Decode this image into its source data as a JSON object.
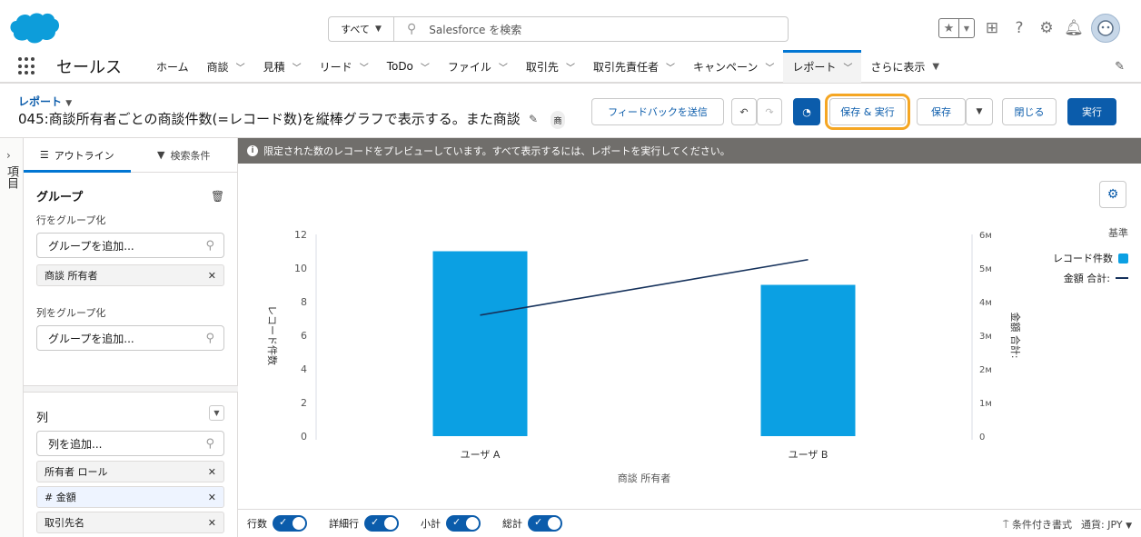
{
  "header": {
    "search_scope": "すべて",
    "search_placeholder": "Salesforce を検索"
  },
  "nav": {
    "app_name": "セールス",
    "items": [
      {
        "label": "ホーム"
      },
      {
        "label": "商談"
      },
      {
        "label": "見積"
      },
      {
        "label": "リード"
      },
      {
        "label": "ToDo"
      },
      {
        "label": "ファイル"
      },
      {
        "label": "取引先"
      },
      {
        "label": "取引先責任者"
      },
      {
        "label": "キャンペーン"
      },
      {
        "label": "レポート"
      },
      {
        "label": "さらに表示"
      }
    ]
  },
  "report": {
    "type_label": "レポート",
    "title": "045:商談所有者ごとの商談件数(=レコード数)を縦棒グラフで表示する。また商談",
    "more_label": "商",
    "buttons": {
      "feedback": "フィードバックを送信",
      "save_run": "保存 & 実行",
      "save": "保存",
      "close": "閉じる",
      "run": "実行"
    }
  },
  "rail": {
    "label": "項目"
  },
  "outline": {
    "tab_outline": "アウトライン",
    "tab_filters": "検索条件",
    "groups_title": "グループ",
    "group_rows_label": "行をグループ化",
    "group_placeholder": "グループを追加...",
    "row_group_pill": "商談 所有者",
    "group_cols_label": "列をグループ化",
    "col_group_placeholder": "グループを追加...",
    "columns_title": "列",
    "column_placeholder": "列を追加...",
    "columns": [
      {
        "label": "所有者 ロール"
      },
      {
        "label": "# 金額"
      },
      {
        "label": "取引先名"
      }
    ]
  },
  "preview": {
    "notice": "限定された数のレコードをプレビューしています。すべて表示するには、レポートを実行してください。"
  },
  "chart_data": {
    "type": "bar",
    "categories": [
      "ユーザ A",
      "ユーザ B"
    ],
    "series": [
      {
        "name": "レコード件数",
        "type": "bar",
        "axis": "left",
        "values": [
          11,
          9
        ],
        "color": "#0ba0e3"
      },
      {
        "name": "金額 合計:",
        "type": "line",
        "axis": "right",
        "values": [
          3600000,
          5250000
        ],
        "color": "#16325c"
      }
    ],
    "xlabel": "商談 所有者",
    "ylabel": "レコード件数",
    "y2label": "金額 合計:",
    "ylim": [
      0,
      12
    ],
    "y2lim": [
      0,
      6000000
    ],
    "yticks": [
      "0",
      "2",
      "4",
      "6",
      "8",
      "10",
      "12"
    ],
    "y2ticks": [
      "0",
      "1м",
      "2м",
      "3м",
      "4м",
      "5м",
      "6м"
    ],
    "legend_title": "基準",
    "legend_position": "top-right"
  },
  "footer": {
    "toggles": [
      {
        "label": "行数"
      },
      {
        "label": "詳細行"
      },
      {
        "label": "小計"
      },
      {
        "label": "総計"
      }
    ],
    "conditional_format": "条件付き書式",
    "currency": "通貨: JPY"
  }
}
